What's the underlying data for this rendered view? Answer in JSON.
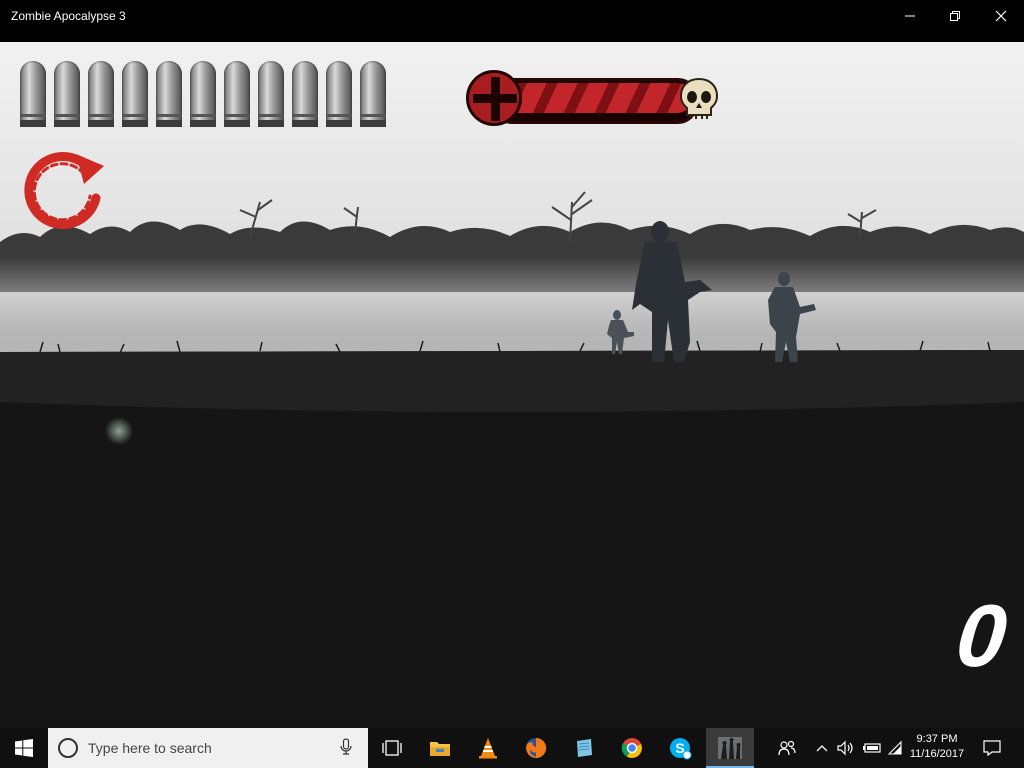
{
  "window": {
    "title": "Zombie Apocalypse 3"
  },
  "hud": {
    "bullets": 11,
    "health_fraction": 1.0,
    "score": "0"
  },
  "colors": {
    "health_red": "#c3262a",
    "reload_red": "#d02a25",
    "taskbar_bg": "#101010",
    "accent": "#76b9ed"
  },
  "icons": {
    "minimize": "minimize-icon",
    "maximize": "restore-icon",
    "close": "close-icon",
    "reload": "reload-icon",
    "health": "health-cross-icon",
    "skull": "skull-icon"
  },
  "taskbar": {
    "search_placeholder": "Type here to search",
    "apps": [
      "task-view",
      "file-explorer",
      "vlc",
      "firefox",
      "notepad",
      "chrome",
      "skype",
      "zombie-apocalypse-3"
    ],
    "clock_time": "9:37 PM",
    "clock_date": "11/16/2017"
  }
}
